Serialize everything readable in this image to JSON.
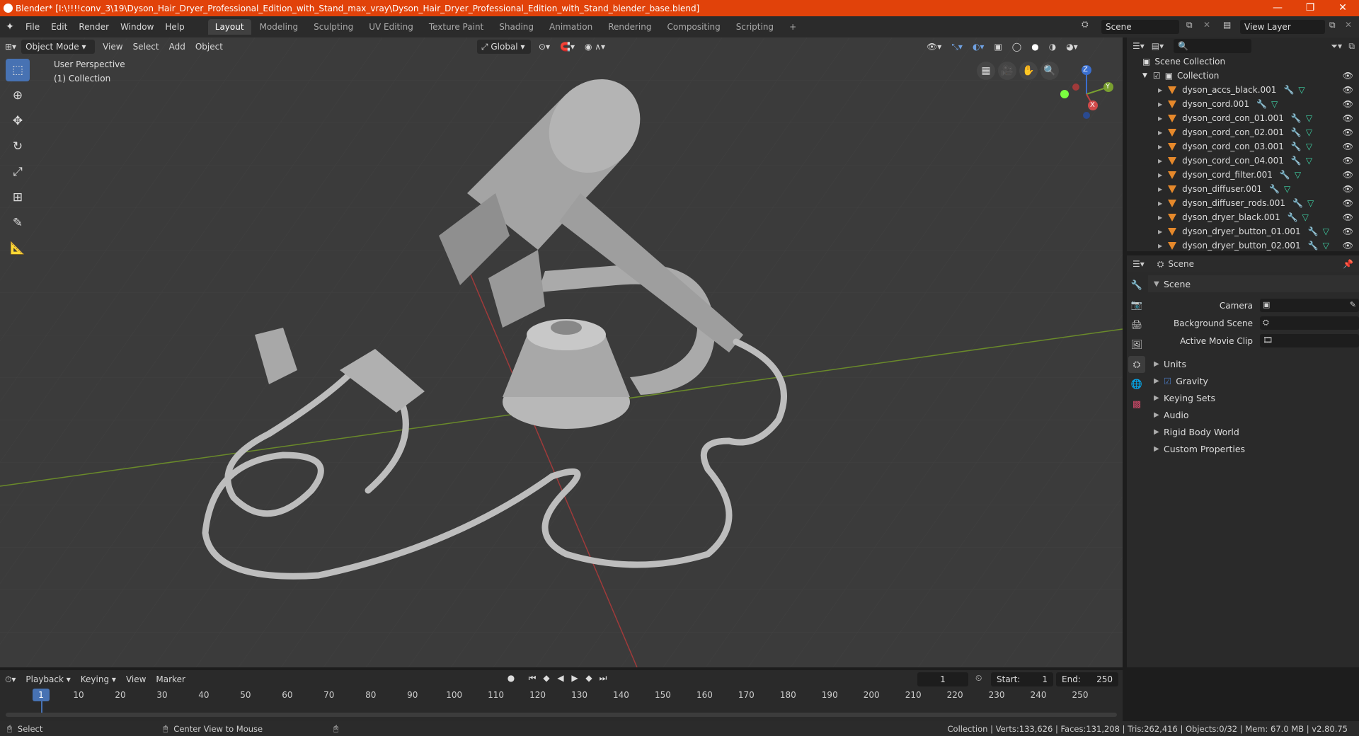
{
  "window": {
    "title": "Blender* [I:\\!!!!conv_3\\19\\Dyson_Hair_Dryer_Professional_Edition_with_Stand_max_vray\\Dyson_Hair_Dryer_Professional_Edition_with_Stand_blender_base.blend]",
    "minimize": "—",
    "maximize": "❐",
    "close": "✕"
  },
  "menu": [
    "File",
    "Edit",
    "Render",
    "Window",
    "Help"
  ],
  "workspaces": [
    "Layout",
    "Modeling",
    "Sculpting",
    "UV Editing",
    "Texture Paint",
    "Shading",
    "Animation",
    "Rendering",
    "Compositing",
    "Scripting"
  ],
  "add_workspace": "+",
  "scene_field": "Scene",
  "view_layer_field": "View Layer",
  "viewport": {
    "mode": "Object Mode",
    "menus": [
      "View",
      "Select",
      "Add",
      "Object"
    ],
    "transform": "Global",
    "perspective_label": "User Perspective",
    "collection_label": "(1) Collection",
    "gizmo": {
      "z": "Z",
      "y": "Y",
      "x": "X"
    }
  },
  "outliner": {
    "root": "Scene Collection",
    "collection": "Collection",
    "items": [
      "dyson_accs_black.001",
      "dyson_cord.001",
      "dyson_cord_con_01.001",
      "dyson_cord_con_02.001",
      "dyson_cord_con_03.001",
      "dyson_cord_con_04.001",
      "dyson_cord_filter.001",
      "dyson_diffuser.001",
      "dyson_diffuser_rods.001",
      "dyson_dryer_black.001",
      "dyson_dryer_button_01.001",
      "dyson_dryer_button_02.001"
    ]
  },
  "properties": {
    "context": "Scene",
    "panel": "Scene",
    "camera_label": "Camera",
    "bg_scene_label": "Background Scene",
    "movie_clip_label": "Active Movie Clip",
    "subpanels": [
      "Units",
      "Gravity",
      "Keying Sets",
      "Audio",
      "Rigid Body World",
      "Custom Properties"
    ]
  },
  "timeline": {
    "menus": [
      "Playback",
      "Keying",
      "View",
      "Marker"
    ],
    "current_frame": "1",
    "start_label": "Start:",
    "start": "1",
    "end_label": "End:",
    "end": "250",
    "ruler": [
      "1",
      "10",
      "20",
      "30",
      "40",
      "50",
      "60",
      "70",
      "80",
      "90",
      "100",
      "110",
      "120",
      "130",
      "140",
      "150",
      "160",
      "170",
      "180",
      "190",
      "200",
      "210",
      "220",
      "230",
      "240",
      "250"
    ]
  },
  "status": {
    "select": "Select",
    "center": "Center View to Mouse",
    "stats": "Collection | Verts:133,626 | Faces:131,208 | Tris:262,416 | Objects:0/32 | Mem: 67.0 MB | v2.80.75"
  },
  "colors": {
    "accent": "#4772b3",
    "titlebar": "#e1420a",
    "mesh_object": "#e6892b",
    "mesh_data": "#3fd3a6"
  }
}
